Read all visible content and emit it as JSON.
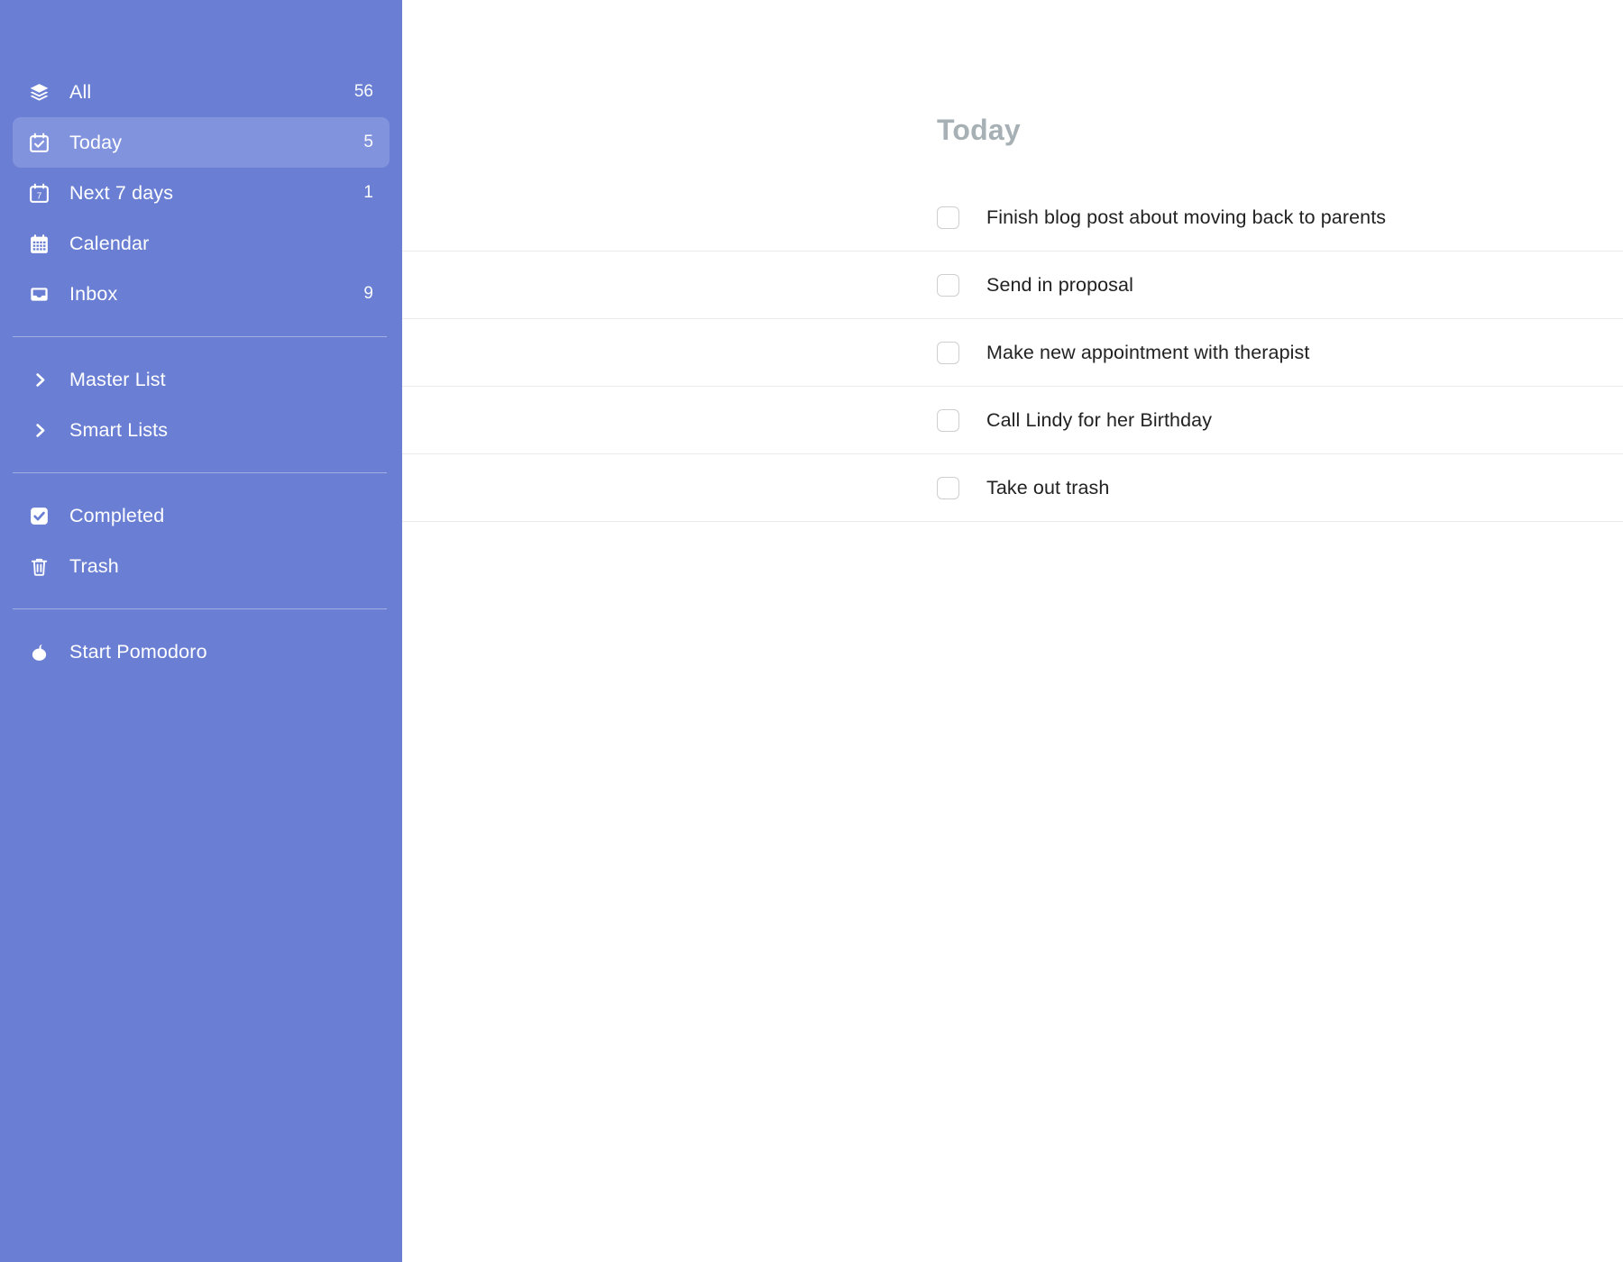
{
  "theme": {
    "sidebar_bg": "#6a7fd4",
    "sidebar_selected_bg": "#8293de",
    "sidebar_text": "#ffffff",
    "main_bg": "#ffffff",
    "title_color": "#a7b0b4",
    "task_text_color": "#222222",
    "row_divider": "#ebebeb",
    "checkbox_border": "#cfcfcf"
  },
  "sidebar": {
    "primary_items": [
      {
        "label": "All",
        "count": "56",
        "icon": "layers-icon",
        "selected": false
      },
      {
        "label": "Today",
        "count": "5",
        "icon": "calendar-check-icon",
        "selected": true
      },
      {
        "label": "Next 7 days",
        "count": "1",
        "icon": "calendar-seven-icon",
        "selected": false
      },
      {
        "label": "Calendar",
        "count": "",
        "icon": "calendar-grid-icon",
        "selected": false
      },
      {
        "label": "Inbox",
        "count": "9",
        "icon": "inbox-tray-icon",
        "selected": false
      }
    ],
    "group_items": [
      {
        "label": "Master List",
        "icon": "chevron-right-icon"
      },
      {
        "label": "Smart Lists",
        "icon": "chevron-right-icon"
      }
    ],
    "utility_items": [
      {
        "label": "Completed",
        "icon": "checkbox-checked-icon"
      },
      {
        "label": "Trash",
        "icon": "trash-icon"
      }
    ],
    "pomodoro": {
      "label": "Start Pomodoro",
      "icon": "tomato-icon"
    }
  },
  "main": {
    "title": "Today",
    "tasks": [
      {
        "text": "Finish blog post about moving back to parents",
        "checked": false
      },
      {
        "text": "Send in proposal",
        "checked": false
      },
      {
        "text": "Make new appointment with therapist",
        "checked": false
      },
      {
        "text": "Call Lindy for her Birthday",
        "checked": false
      },
      {
        "text": "Take out trash",
        "checked": false
      }
    ]
  }
}
